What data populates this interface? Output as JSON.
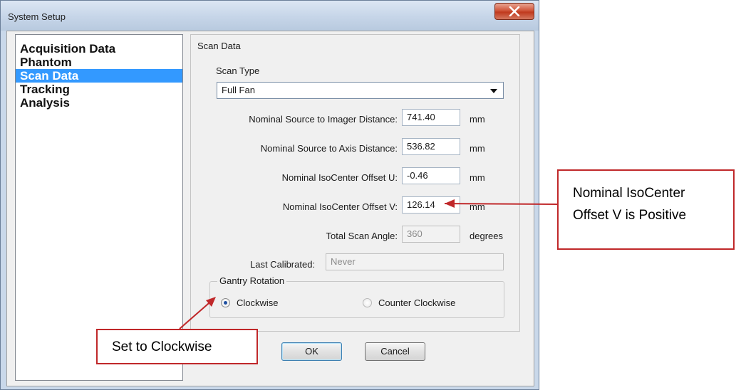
{
  "window": {
    "title": "System Setup"
  },
  "nav": {
    "items": [
      {
        "label": "Acquisition Data"
      },
      {
        "label": "Phantom"
      },
      {
        "label": "Scan Data"
      },
      {
        "label": "Tracking"
      },
      {
        "label": "Analysis"
      }
    ],
    "selected": "Scan Data"
  },
  "panel": {
    "title": "Scan Data",
    "scan_type_label": "Scan Type",
    "scan_type_value": "Full Fan",
    "fields": [
      {
        "label": "Nominal Source to Imager Distance:",
        "value": "741.40",
        "unit": "mm"
      },
      {
        "label": "Nominal Source to Axis Distance:",
        "value": "536.82",
        "unit": "mm"
      },
      {
        "label": "Nominal IsoCenter Offset U:",
        "value": "-0.46",
        "unit": "mm"
      },
      {
        "label": "Nominal IsoCenter Offset V:",
        "value": "126.14",
        "unit": "mm"
      },
      {
        "label": "Total Scan Angle:",
        "value": "360",
        "unit": "degrees"
      }
    ],
    "last_calibrated_label": "Last Calibrated:",
    "last_calibrated_value": "Never",
    "gantry": {
      "label": "Gantry Rotation",
      "options": [
        {
          "label": "Clockwise",
          "checked": true
        },
        {
          "label": "Counter Clockwise",
          "checked": false
        }
      ]
    }
  },
  "buttons": {
    "ok": "OK",
    "cancel": "Cancel"
  },
  "annotations": {
    "callout_right_line1": "Nominal IsoCenter",
    "callout_right_line2": "Offset V is Positive",
    "callout_left": "Set to Clockwise",
    "color": "#c0282a"
  }
}
